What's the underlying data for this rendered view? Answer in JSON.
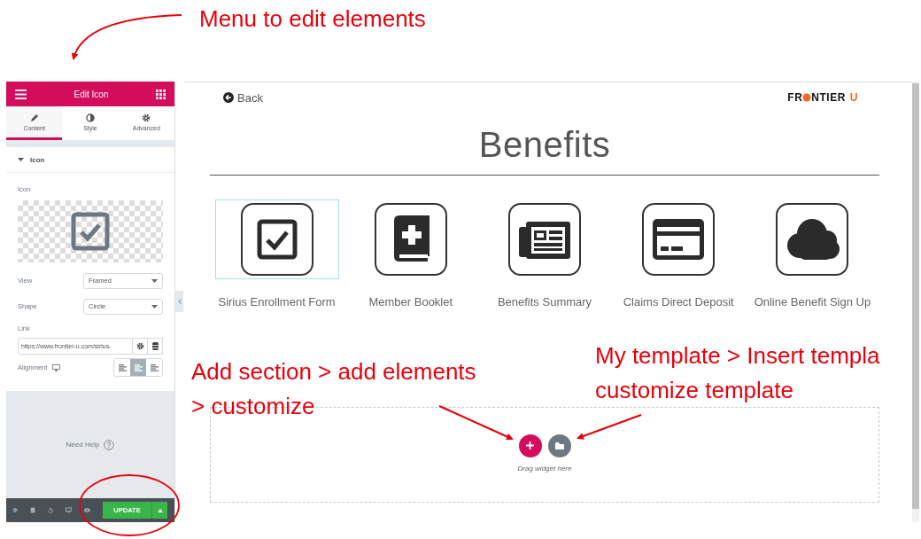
{
  "annotations": [
    {
      "text": "Menu to edit elements",
      "kind": "menu"
    },
    {
      "text": "Add section > add elements\n> customize",
      "kind": "add"
    },
    {
      "text": "My template > Insert templa\ncustomize template",
      "kind": "template"
    }
  ],
  "panel": {
    "title": "Edit Icon",
    "tabs": [
      {
        "label": "Content",
        "selected": true
      },
      {
        "label": "Style",
        "selected": false
      },
      {
        "label": "Advanced",
        "selected": false
      }
    ],
    "section": {
      "title": "Icon",
      "expanded": true
    },
    "icon_label": "Icon",
    "view": {
      "label": "View",
      "value": "Framed"
    },
    "shape": {
      "label": "Shape",
      "value": "Circle"
    },
    "link": {
      "label": "Link",
      "value": "https://www.frontier-u.com/sirius-"
    },
    "alignment": {
      "label": "Alignment",
      "options": [
        {
          "selected": false
        },
        {
          "selected": true
        },
        {
          "selected": false
        }
      ]
    },
    "help": "Need Help",
    "update": "UPDATE"
  },
  "preview": {
    "back": "Back",
    "logo": {
      "start": "FR",
      "middle": "NTIER",
      "end": "U"
    },
    "heading": "Benefits",
    "items": [
      {
        "label": "Sirius Enrollment Form",
        "kind": "checkbox",
        "selected": true
      },
      {
        "label": "Member Booklet",
        "kind": "book",
        "selected": false
      },
      {
        "label": "Benefits Summary",
        "kind": "newspaper",
        "selected": false
      },
      {
        "label": "Claims Direct Deposit",
        "kind": "card",
        "selected": false
      },
      {
        "label": "Online Benefit Sign Up",
        "kind": "cloud",
        "selected": false
      }
    ],
    "dropzone": "Drag widget here"
  }
}
